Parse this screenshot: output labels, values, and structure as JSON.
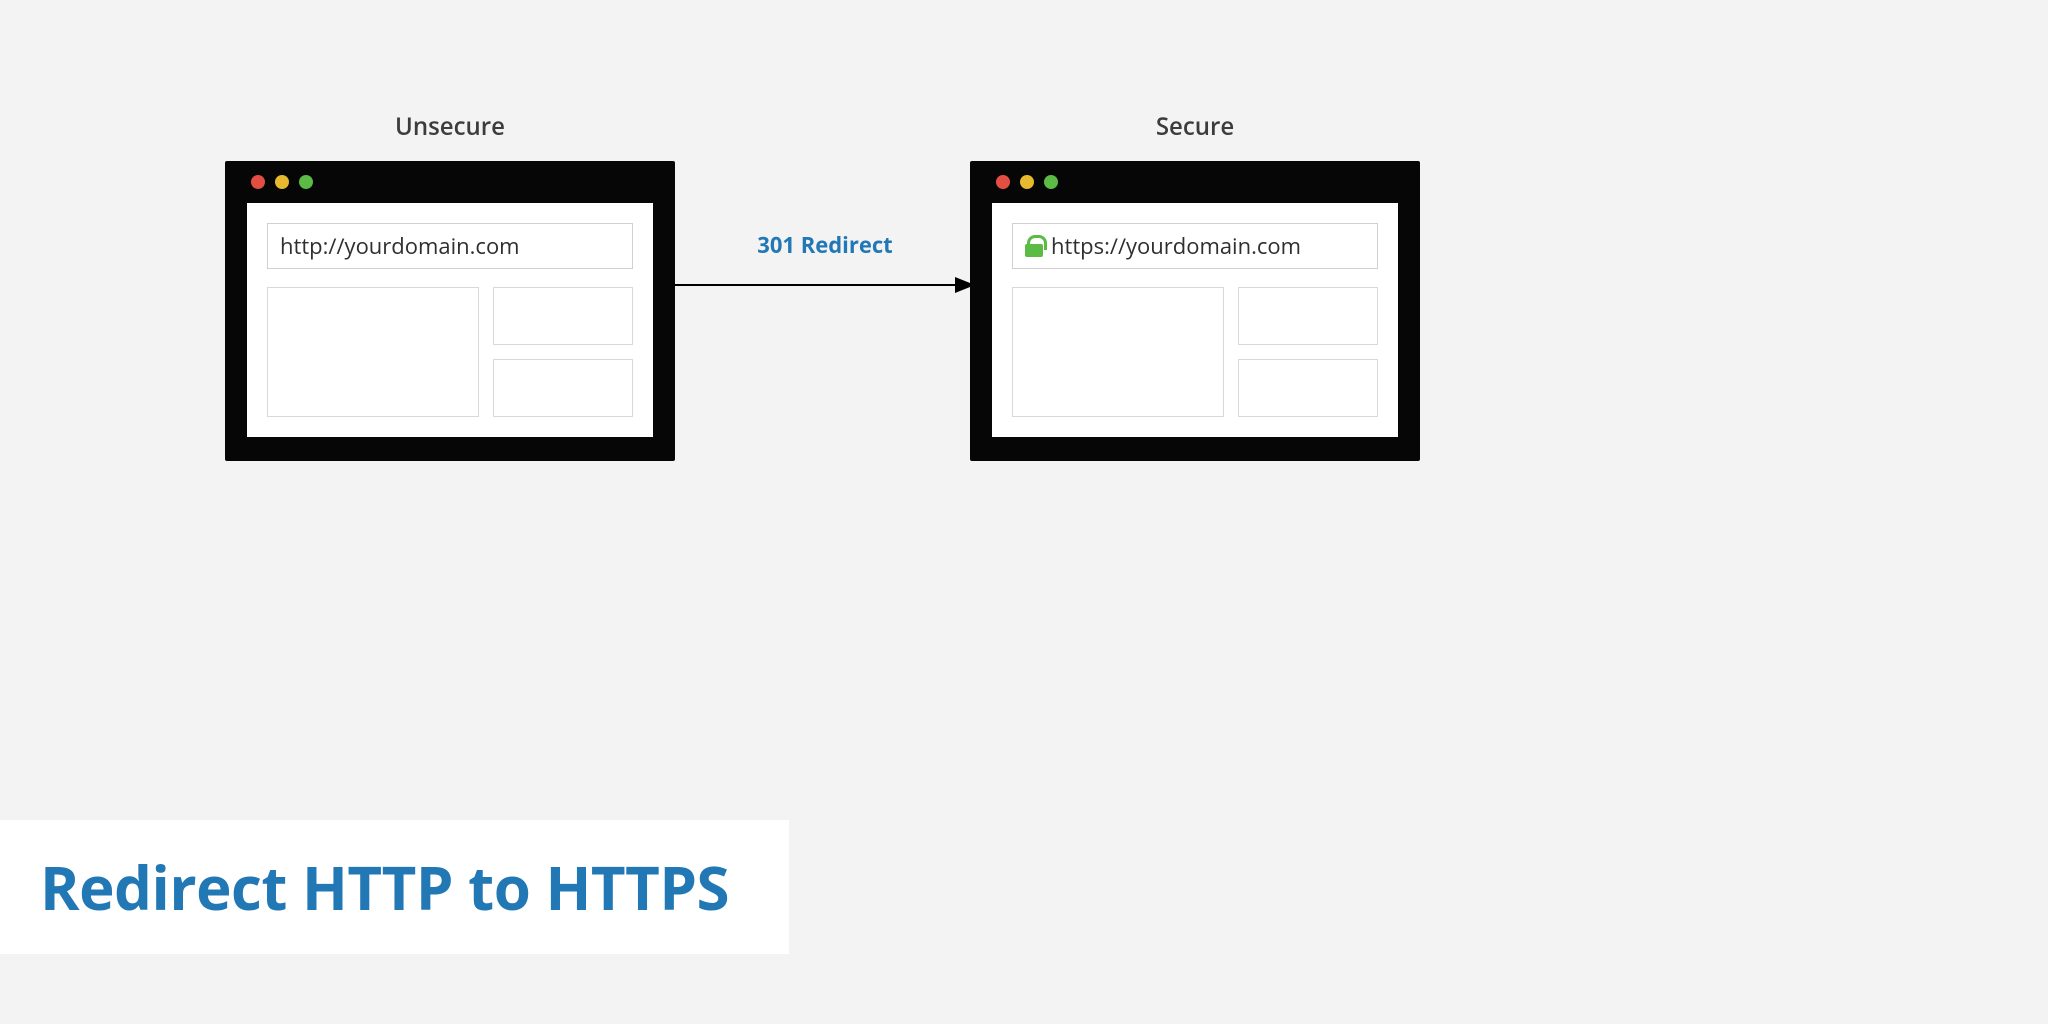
{
  "colors": {
    "accent": "#2178b5",
    "lock_green": "#5bbb45",
    "dot_red": "#e34e42",
    "dot_yellow": "#e7b92f",
    "dot_green": "#5bbb45"
  },
  "left_browser": {
    "label": "Unsecure",
    "url": "http://yourdomain.com",
    "has_lock": false
  },
  "right_browser": {
    "label": "Secure",
    "url": "https://yourdomain.com",
    "has_lock": true
  },
  "arrow": {
    "label": "301 Redirect"
  },
  "caption": "Redirect HTTP to HTTPS"
}
